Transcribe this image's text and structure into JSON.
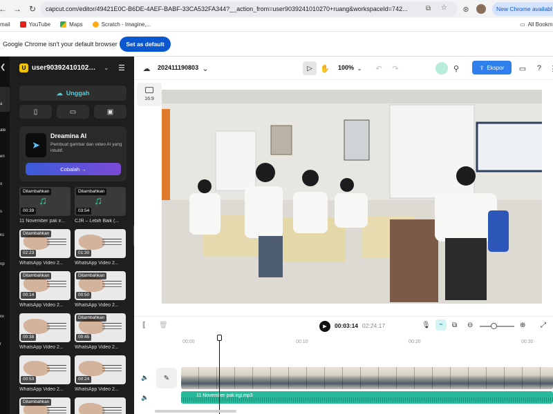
{
  "browser": {
    "url": "capcut.com/editor/49421E0C-B6DE-4AEF-BABF-33CA532FA344?__action_from=user9039241010270+ruang&workspaceId=742...",
    "update_pill": "New Chrome availabl",
    "bookmarks": [
      "mail",
      "YouTube",
      "Maps",
      "Scratch - Imagine,...",
      "All Bookm"
    ],
    "default_msg": "Google Chrome isn't your default browser",
    "set_default_label": "Set as default"
  },
  "rail": {
    "items": [
      "a",
      "ate",
      "en",
      "o",
      "s",
      "ks",
      "rip",
      "isi",
      "r"
    ]
  },
  "media_panel": {
    "avatar_letter": "U",
    "username": "user90392410102…",
    "upload_label": "Unggah",
    "dreamina": {
      "title": "Dreamina AI",
      "desc": "Pembuat gambar dan video AI yang intuitif.",
      "try_label": "Cobalah →"
    },
    "tiles": [
      {
        "badge": "Ditambahkan",
        "dur": "00:39",
        "caption": "11 November pak ir...",
        "kind": "audio"
      },
      {
        "badge": "Ditambahkan",
        "dur": "03:54",
        "caption": "CJR – Lebih Baik (...",
        "kind": "audio"
      },
      {
        "badge": "Ditambahkan",
        "dur": "02:23",
        "caption": "WhatsApp Video 2...",
        "kind": "video"
      },
      {
        "badge": "",
        "dur": "01:30",
        "caption": "WhatsApp Video 2...",
        "kind": "video"
      },
      {
        "badge": "Ditambahkan",
        "dur": "00:14",
        "caption": "WhatsApp Video 2...",
        "kind": "video"
      },
      {
        "badge": "Ditambahkan",
        "dur": "00:50",
        "caption": "WhatsApp Video 2...",
        "kind": "video"
      },
      {
        "badge": "",
        "dur": "00:38",
        "caption": "WhatsApp Video 2...",
        "kind": "video"
      },
      {
        "badge": "Ditambahkan",
        "dur": "00:45",
        "caption": "WhatsApp Video 2...",
        "kind": "video"
      },
      {
        "badge": "",
        "dur": "00:53",
        "caption": "WhatsApp Video 2...",
        "kind": "video"
      },
      {
        "badge": "",
        "dur": "00:24",
        "caption": "WhatsApp Video 2...",
        "kind": "video"
      },
      {
        "badge": "Ditambahkan",
        "dur": "",
        "caption": "",
        "kind": "video"
      },
      {
        "badge": "",
        "dur": "",
        "caption": "",
        "kind": "video"
      }
    ]
  },
  "editor": {
    "project_name": "202411190803",
    "zoom": "100%",
    "export_label": "Ekspor",
    "aspect_label": "16:9",
    "current_time": "00:03:14",
    "total_time": "02:24:17",
    "ruler": [
      "00:00",
      "00:10",
      "00:20",
      "00:30"
    ],
    "audio_clip_label": "11 November pak irgi.mp3"
  },
  "colors": {
    "accent": "#2f80ed",
    "upload_text": "#4ad0d9",
    "audio_track": "#27b99a",
    "panel_bg": "#1e1e1e"
  }
}
